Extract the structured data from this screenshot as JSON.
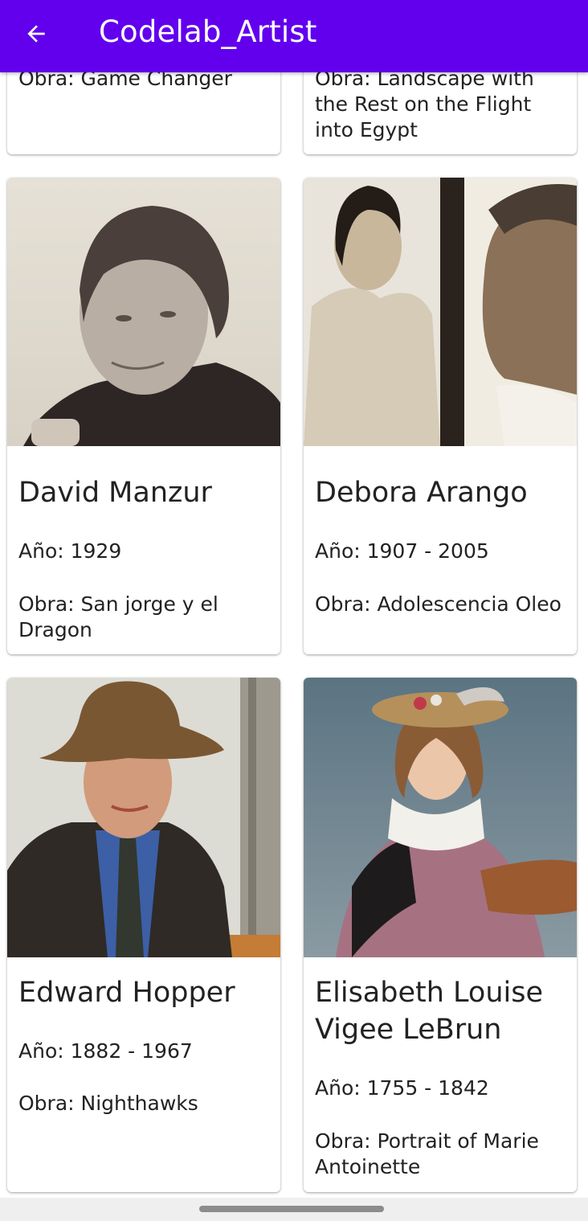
{
  "app_bar": {
    "title": "Codelab_Artist",
    "back_icon": "arrow-left-icon"
  },
  "cards": [
    {
      "work": "Obra: Game Changer"
    },
    {
      "work": "Obra: Landscape with the Rest on the Flight into Egypt"
    },
    {
      "name": "David Manzur",
      "year": "Año: 1929",
      "work": "Obra: San jorge y el Dragon"
    },
    {
      "name": "Debora Arango",
      "year": "Año: 1907 - 2005",
      "work": "Obra: Adolescencia Oleo"
    },
    {
      "name": "Edward Hopper",
      "year": "Año: 1882 - 1967",
      "work": "Obra: Nighthawks"
    },
    {
      "name": "Elisabeth Louise Vigee LeBrun",
      "year": "Año: 1755 - 1842",
      "work": "Obra: Portrait of Marie Antoinette"
    }
  ],
  "colors": {
    "app_bar": "#6200ee",
    "text": "#222222"
  }
}
